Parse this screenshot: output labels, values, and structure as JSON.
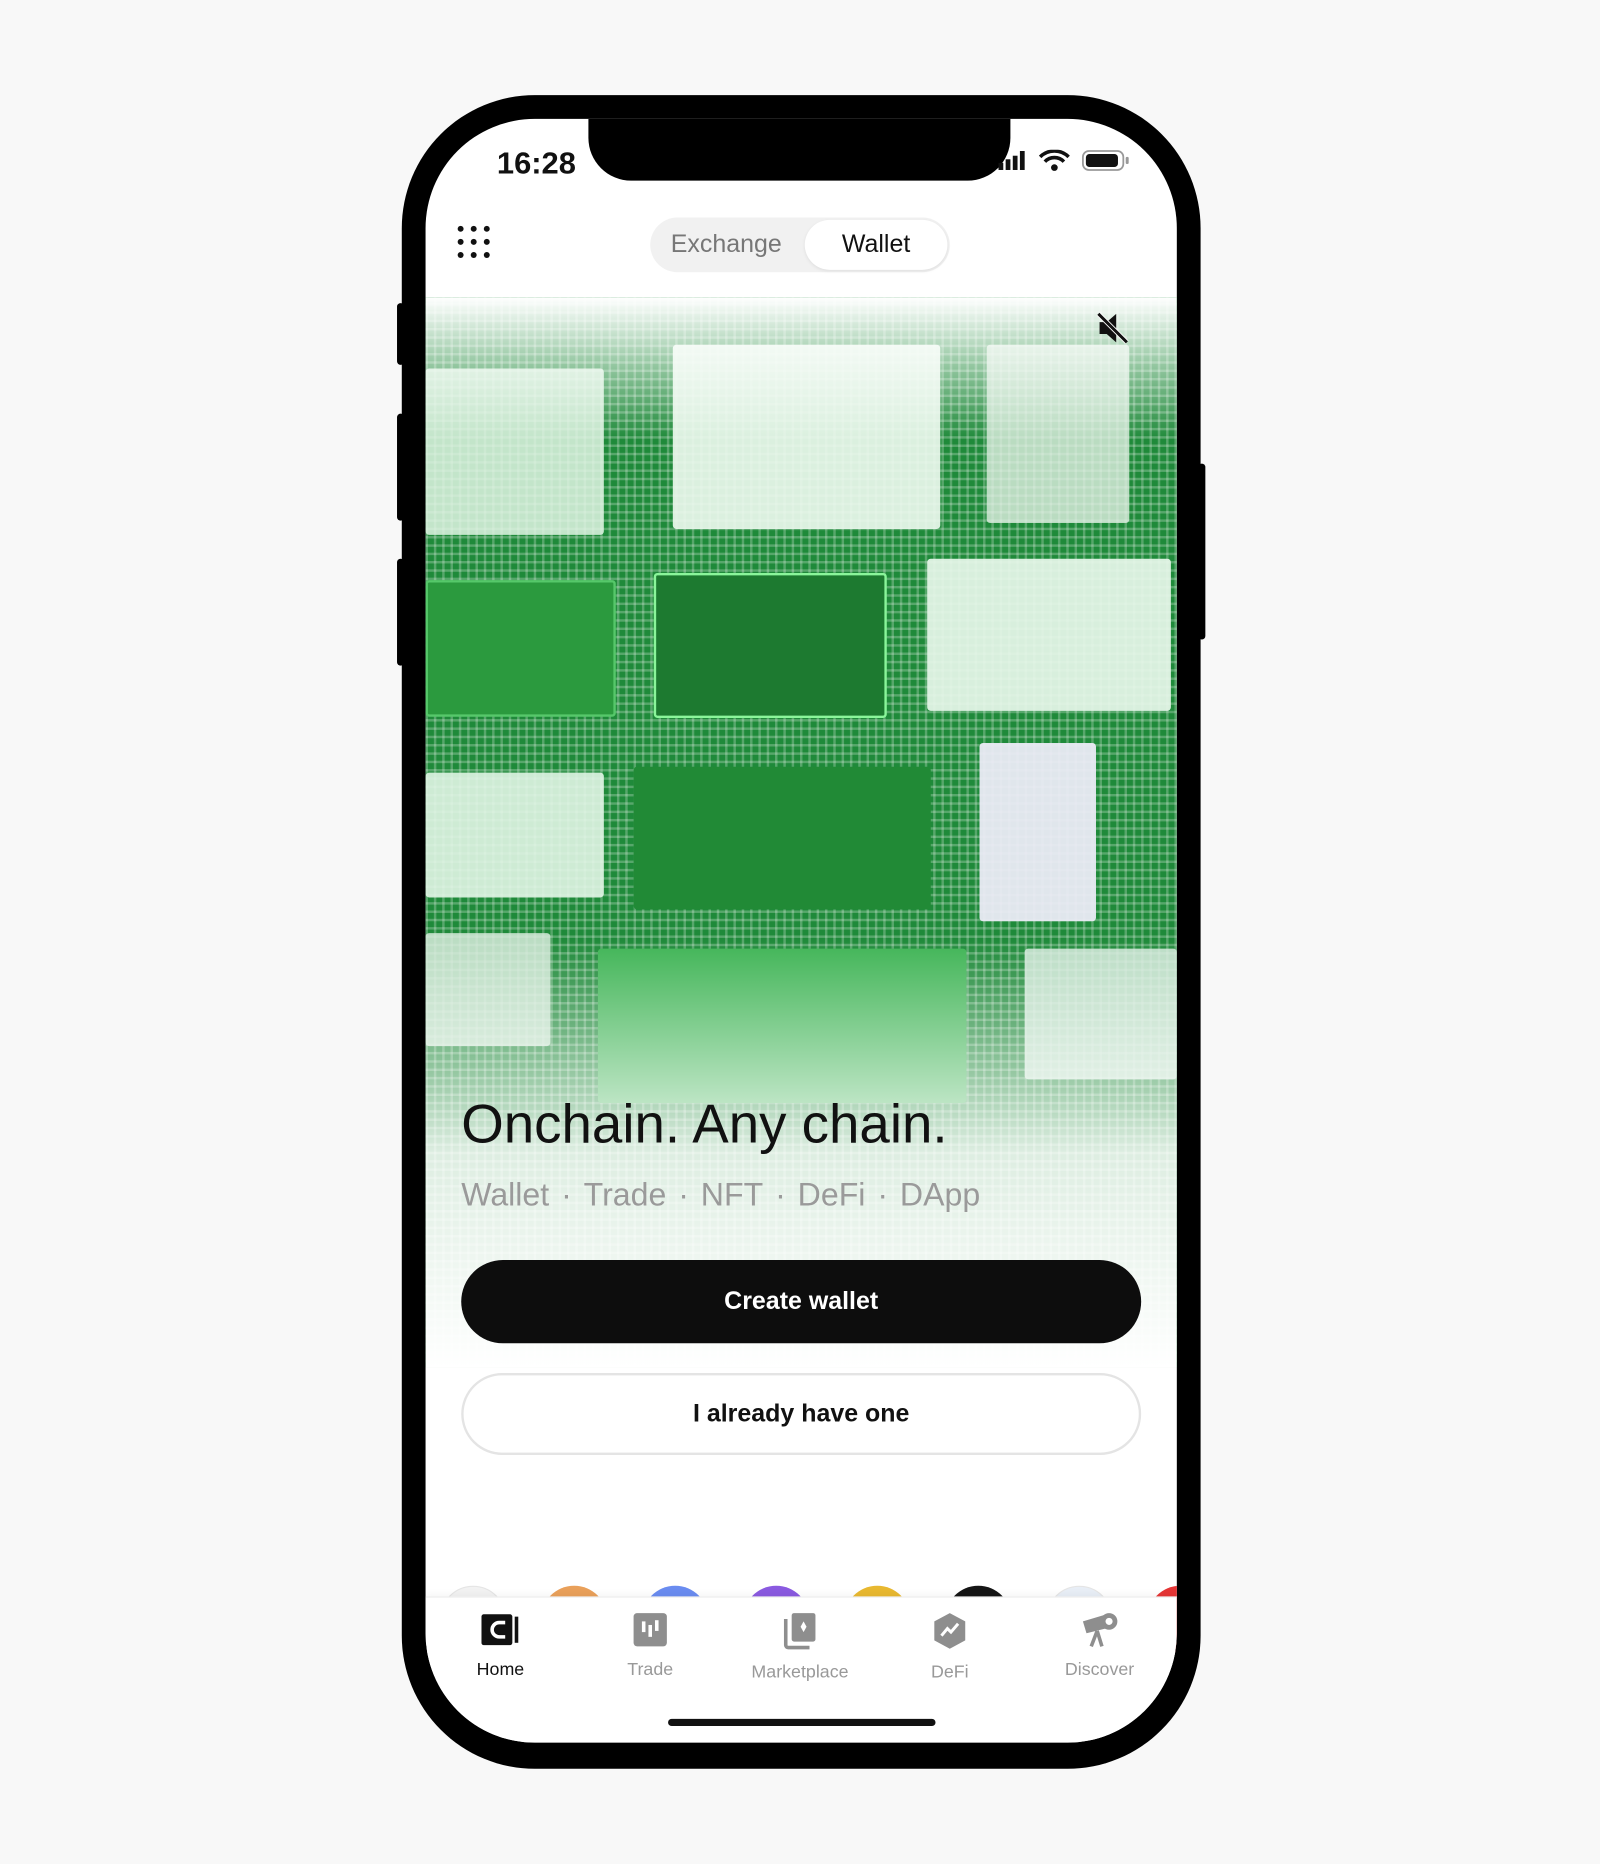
{
  "status_bar": {
    "time": "16:28"
  },
  "header": {
    "segments": [
      {
        "label": "Exchange",
        "active": false
      },
      {
        "label": "Wallet",
        "active": true
      }
    ]
  },
  "hero": {
    "headline": "Onchain. Any chain.",
    "features": [
      "Wallet",
      "Trade",
      "NFT",
      "DeFi",
      "DApp"
    ],
    "separator": "·",
    "mute_icon": "speaker-muted-icon"
  },
  "actions": {
    "create_label": "Create wallet",
    "existing_label": "I already have one"
  },
  "coin_colors": [
    "#f2f2f2",
    "#e9a05a",
    "#6a8cf0",
    "#8a5ae0",
    "#e8b830",
    "#151515",
    "#e8eef6",
    "#e53535"
  ],
  "nav": {
    "items": [
      {
        "label": "Home",
        "icon": "wallet-icon",
        "active": true
      },
      {
        "label": "Trade",
        "icon": "chart-icon"
      },
      {
        "label": "Marketplace",
        "icon": "nft-cards-icon"
      },
      {
        "label": "DeFi",
        "icon": "defi-hexagon-icon"
      },
      {
        "label": "Discover",
        "icon": "telescope-icon"
      }
    ]
  },
  "colors": {
    "primary": "#0d0d0d",
    "hero_green": "#1f8a3a",
    "inactive": "#999999"
  }
}
